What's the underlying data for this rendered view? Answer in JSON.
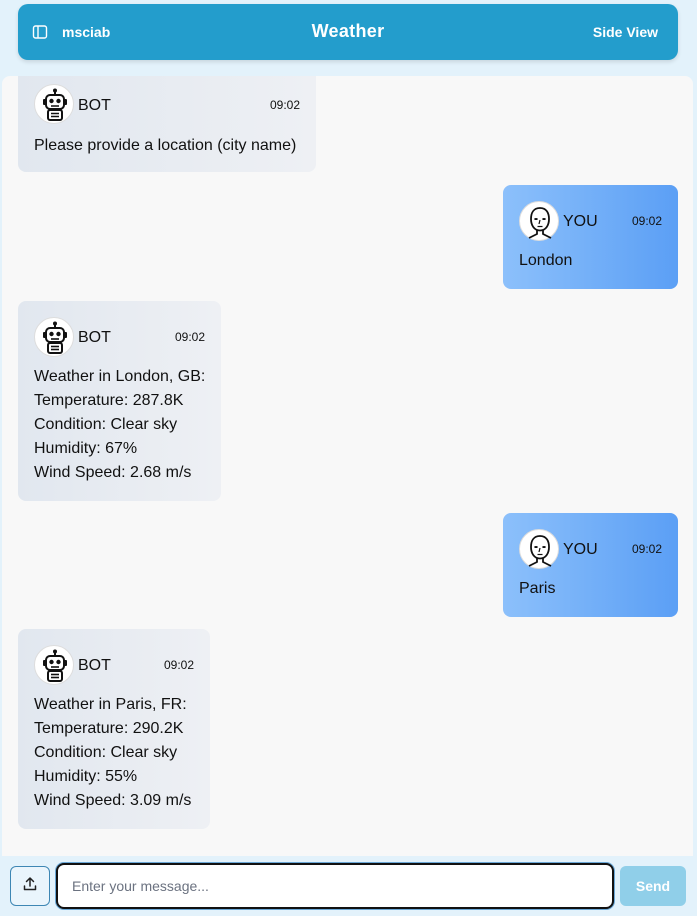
{
  "header": {
    "user": "msciab",
    "title": "Weather",
    "side_view_label": "Side View",
    "sidebar_icon": "sidebar-toggle-icon"
  },
  "messages": [
    {
      "sender": "BOT",
      "time": "09:02",
      "lines": [
        "Please provide a location (city name)"
      ]
    },
    {
      "sender": "YOU",
      "time": "09:02",
      "lines": [
        "London"
      ]
    },
    {
      "sender": "BOT",
      "time": "09:02",
      "lines": [
        "Weather in London, GB:",
        "Temperature: 287.8K",
        "Condition: Clear sky",
        "Humidity: 67%",
        "Wind Speed: 2.68 m/s"
      ]
    },
    {
      "sender": "YOU",
      "time": "09:02",
      "lines": [
        "Paris"
      ]
    },
    {
      "sender": "BOT",
      "time": "09:02",
      "lines": [
        "Weather in Paris, FR:",
        "Temperature: 290.2K",
        "Condition: Clear sky",
        "Humidity: 55%",
        "Wind Speed: 3.09 m/s"
      ]
    }
  ],
  "composer": {
    "placeholder": "Enter your message...",
    "value": "",
    "send_label": "Send",
    "upload_icon": "upload-icon"
  },
  "colors": {
    "header_bg": "#239dcc",
    "page_bg": "#e3f2fb",
    "user_bubble": "#5b9ff5",
    "bot_bubble": "#e1e7ef",
    "send_button": "#90cfe9"
  }
}
